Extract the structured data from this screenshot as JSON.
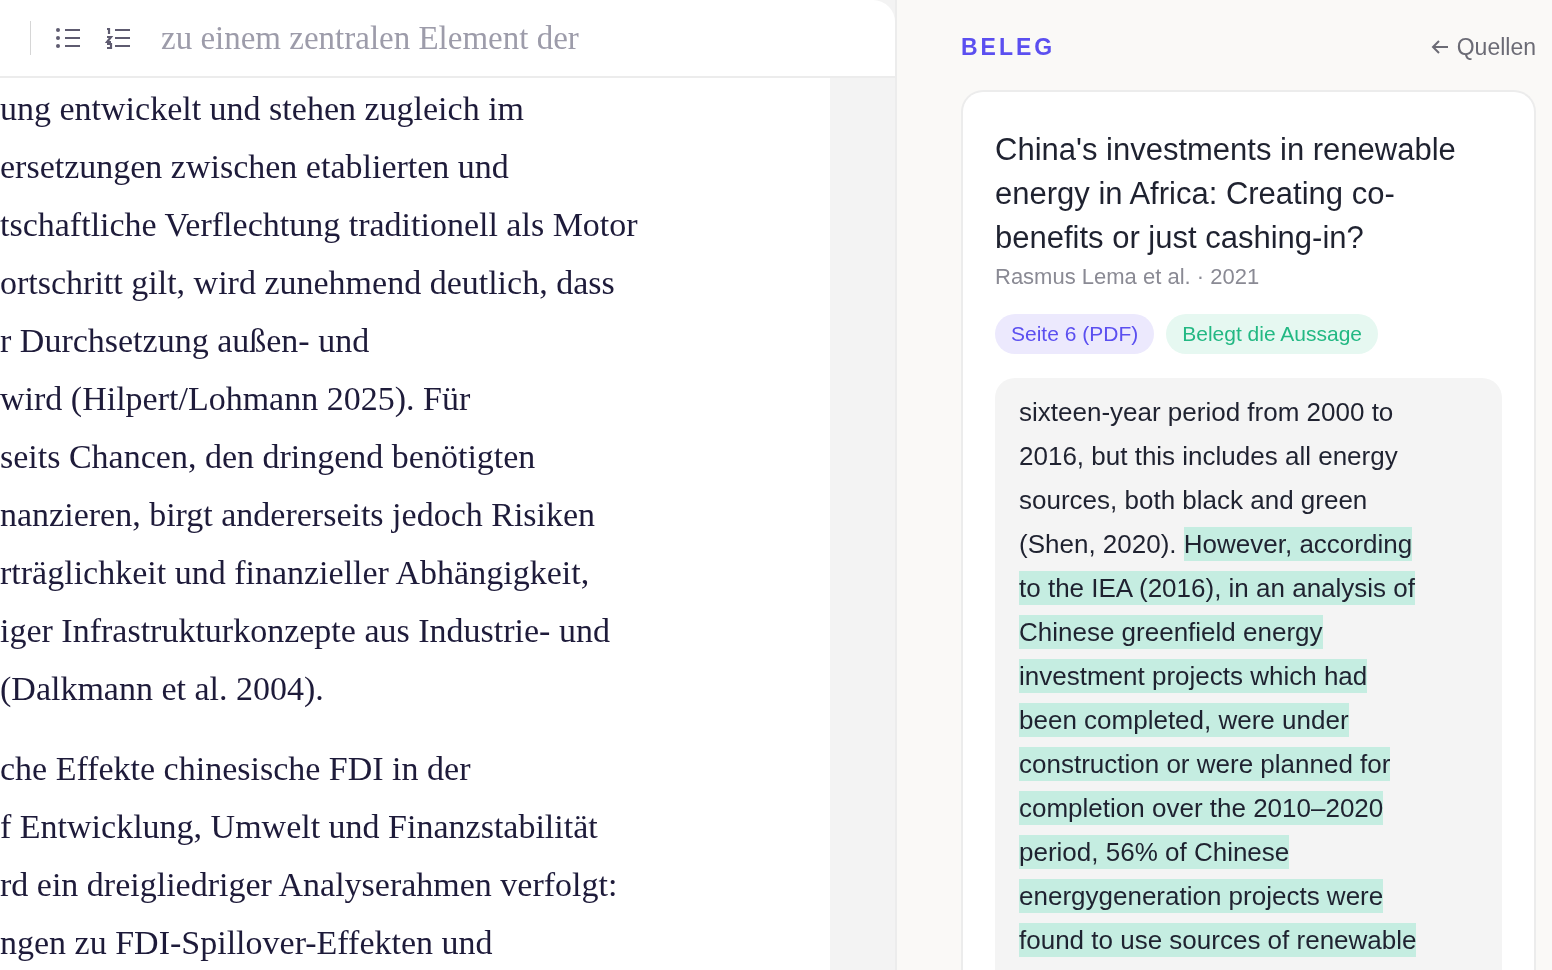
{
  "toolbar": {
    "faded_line": "zu einem zentralen Element der"
  },
  "document": {
    "paragraphs": [
      {
        "lines": [
          "ung entwickelt und stehen zugleich im",
          "ersetzungen zwischen etablierten und",
          "tschaftliche Verflechtung traditionell als Motor",
          "ortschritt gilt, wird zunehmend deutlich, dass",
          "r Durchsetzung außen- und",
          "wird (Hilpert/Lohmann 2025). Für",
          "seits Chancen, den dringend benötigten",
          "nanzieren, birgt andererseits jedoch Risiken",
          "rträglichkeit und finanzieller Abhängigkeit,",
          "iger Infrastrukturkonzepte aus Industrie- und",
          "(Dalkmann et al. 2004)."
        ]
      },
      {
        "lines": [
          "che Effekte chinesische FDI in der",
          "f Entwicklung, Umwelt und Finanzstabilität",
          "rd ein dreigliedriger Analyserahmen verfolgt:",
          "ngen zu FDI-Spillover-Effekten und"
        ]
      }
    ]
  },
  "panel": {
    "heading": "BELEG",
    "back_link": "Quellen",
    "source": {
      "title": "China's investments in renewable energy in Africa: Creating co-benefits or just cashing-in?",
      "meta": "Rasmus Lema et al. · 2021",
      "tags": [
        {
          "kind": "page",
          "label": "Seite 6 (PDF)"
        },
        {
          "kind": "support",
          "label": "Belegt die Aussage"
        }
      ],
      "excerpt": [
        [
          {
            "text": "sixteen-year period from 2000 to",
            "highlighted": false
          }
        ],
        [
          {
            "text": "2016, but this includes all energy",
            "highlighted": false
          }
        ],
        [
          {
            "text": "sources, both black and green",
            "highlighted": false
          }
        ],
        [
          {
            "text": "(Shen, 2020). ",
            "highlighted": false
          },
          {
            "text": "However, according",
            "highlighted": true
          }
        ],
        [
          {
            "text": "to the IEA (2016), in an analysis of",
            "highlighted": true
          }
        ],
        [
          {
            "text": "Chinese greenfield energy",
            "highlighted": true
          }
        ],
        [
          {
            "text": "investment projects which had",
            "highlighted": true
          }
        ],
        [
          {
            "text": "been completed, were under",
            "highlighted": true
          }
        ],
        [
          {
            "text": "construction or were planned for",
            "highlighted": true
          }
        ],
        [
          {
            "text": "completion over the 2010–2020",
            "highlighted": true
          }
        ],
        [
          {
            "text": "period, 56% of Chinese",
            "highlighted": true
          }
        ],
        [
          {
            "text": "energygeneration projects were",
            "highlighted": true
          }
        ],
        [
          {
            "text": "found to use sources of renewable",
            "highlighted": true
          }
        ]
      ]
    }
  }
}
